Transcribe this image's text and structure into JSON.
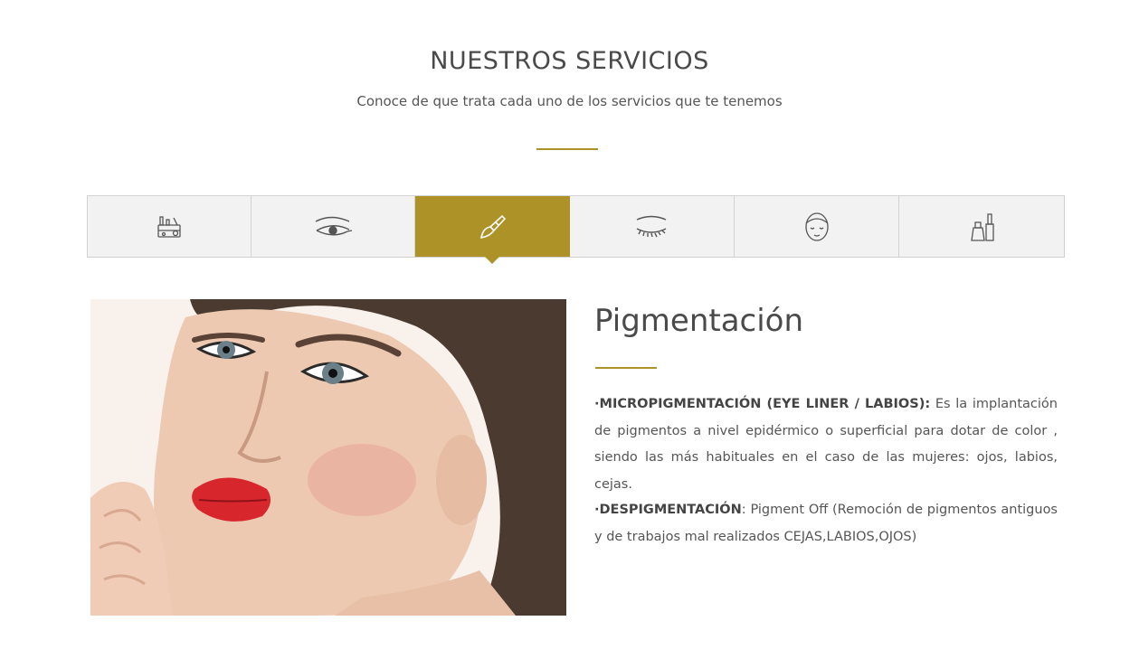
{
  "section": {
    "title": "NUESTROS SERVICIOS",
    "subtitle": "Conoce de que trata cada uno de los servicios que te tenemos"
  },
  "tabs": [
    {
      "icon": "makeup-kit-icon",
      "active": false
    },
    {
      "icon": "eye-makeup-icon",
      "active": false
    },
    {
      "icon": "brush-icon",
      "active": true
    },
    {
      "icon": "closed-eye-lashes-icon",
      "active": false
    },
    {
      "icon": "face-care-icon",
      "active": false
    },
    {
      "icon": "nail-polish-icon",
      "active": false
    }
  ],
  "panel": {
    "title": "Pigmentación",
    "items": [
      {
        "label": "·MICROPIGMENTACIÓN (EYE LINER / LABIOS):",
        "text": " Es la implantación de pigmentos a nivel epidérmico o superficial para dotar de color , siendo las más habituales en el caso de las mujeres: ojos, labios, cejas."
      },
      {
        "label": "·DESPIGMENTACIÓN",
        "text": ": Pigment Off (Remoción de pigmentos antiguos y de trabajos mal realizados CEJAS,LABIOS,OJOS)"
      }
    ]
  },
  "colors": {
    "accent": "#ad9228",
    "tab_bg": "#f2f2f2",
    "text": "#555555"
  }
}
